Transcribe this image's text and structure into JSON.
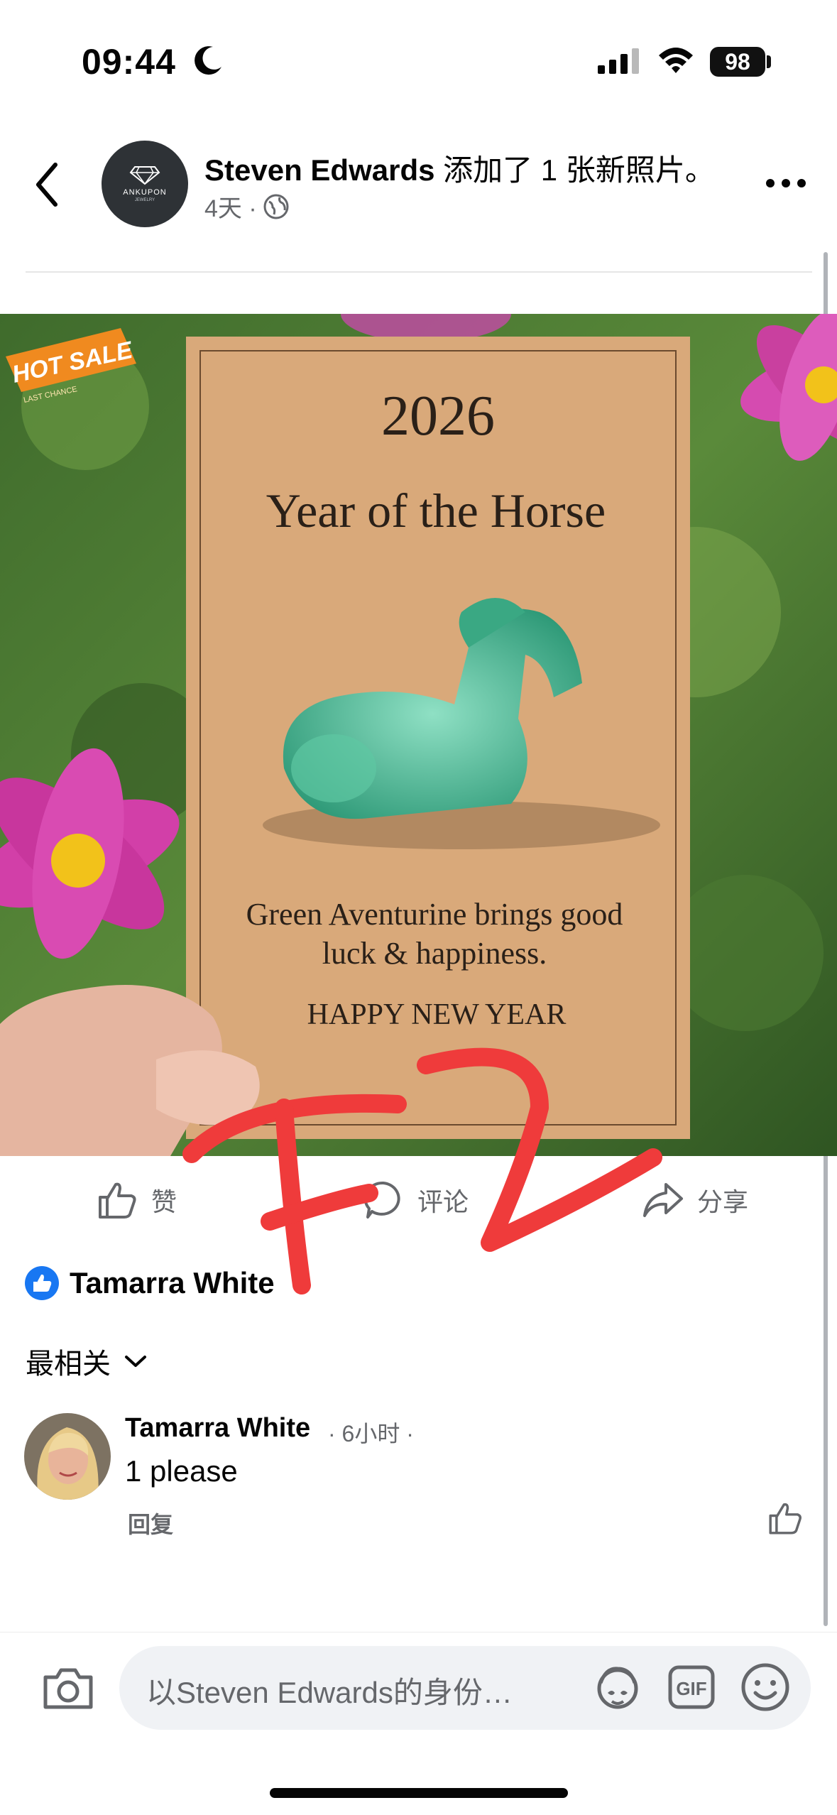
{
  "status_bar": {
    "time": "09:44",
    "battery": "98",
    "icons": [
      "moon-icon",
      "signal-icon",
      "wifi-icon",
      "battery-icon"
    ]
  },
  "post": {
    "author": "Steven Edwards",
    "action_text": " 添加了 1 张新照片。",
    "time_ago": "4天 ·",
    "avatar_brand": "ANKUPON",
    "avatar_brand_sub": "JEWELRY"
  },
  "photo": {
    "badge_main": "HOT SALE",
    "badge_sub": "LAST CHANCE",
    "year": "2026",
    "headline": "Year of the Horse",
    "caption_line1": "Green Aventurine brings good",
    "caption_line2": "luck & happiness.",
    "greeting": "HAPPY NEW YEAR"
  },
  "actions": {
    "like": "赞",
    "comment": "评论",
    "share": "分享"
  },
  "reactions": {
    "names": "Tamarra White"
  },
  "sort": {
    "label": "最相关"
  },
  "comments": [
    {
      "author": "Tamarra White",
      "time": "· 6小时 ·",
      "text": "1 please",
      "reply": "回复"
    }
  ],
  "composer": {
    "placeholder": "以Steven Edwards的身份…"
  },
  "colors": {
    "facebook_blue": "#1877f2",
    "secondary_text": "#65676b",
    "annotation_red": "#ef3b3b"
  }
}
